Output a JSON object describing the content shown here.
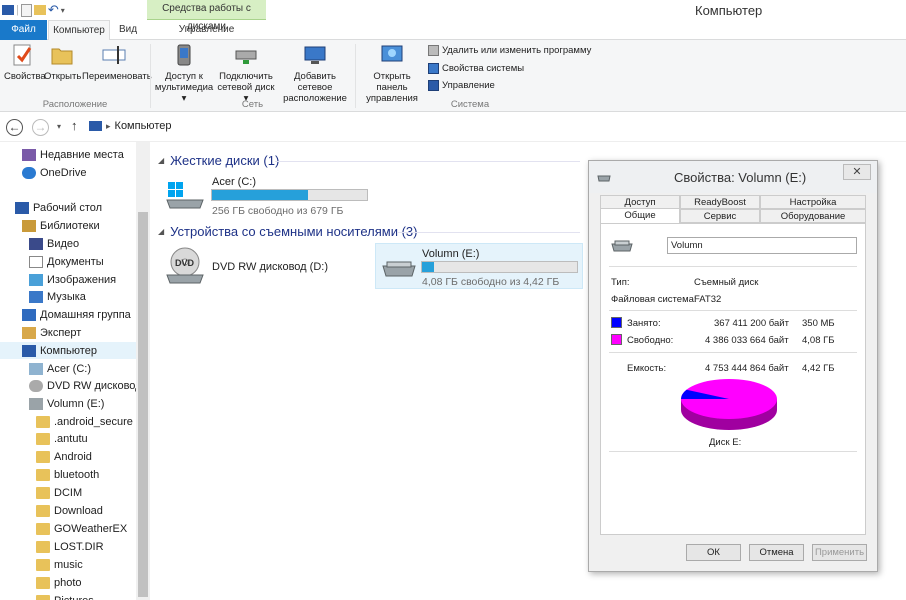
{
  "window": {
    "title": "Компьютер",
    "context_tab": "Средства работы с дисками"
  },
  "tabs": {
    "file": "Файл",
    "computer": "Компьютер",
    "view": "Вид",
    "manage": "Управление"
  },
  "ribbon": {
    "properties": "Свойства",
    "open": "Открыть",
    "rename": "Переименовать",
    "group_location": "Расположение",
    "media_access_1": "Доступ к",
    "media_access_2": "мультимедиа",
    "map_drive_1": "Подключить",
    "map_drive_2": "сетевой диск",
    "add_location_1": "Добавить сетевое",
    "add_location_2": "расположение",
    "group_network": "Сеть",
    "control_panel_1": "Открыть панель",
    "control_panel_2": "управления",
    "uninstall": "Удалить или изменить программу",
    "system_props": "Свойства системы",
    "manage": "Управление",
    "group_system": "Система"
  },
  "address": {
    "path": "Компьютер"
  },
  "nav": {
    "items": [
      "Недавние места",
      "OneDrive",
      "Рабочий стол",
      "Библиотеки",
      "Видео",
      "Документы",
      "Изображения",
      "Музыка",
      "Домашняя группа",
      "Эксперт",
      "Компьютер",
      "Acer (C:)",
      "DVD RW дисковод (",
      "Volumn (E:)",
      ".android_secure",
      ".antutu",
      "Android",
      "bluetooth",
      "DCIM",
      "Download",
      "GOWeatherEX",
      "LOST.DIR",
      "music",
      "photo",
      "Pictures"
    ]
  },
  "content": {
    "hdd_group": "Жесткие диски (1)",
    "removable_group": "Устройства со съемными носителями (3)",
    "drives": [
      {
        "name": "Acer (C:)",
        "free": "256 ГБ свободно из 679 ГБ",
        "used_fraction": 0.62
      },
      {
        "name": "DVD RW дисковод (D:)"
      },
      {
        "name": "Volumn (E:)",
        "free": "4,08 ГБ свободно из 4,42 ГБ",
        "used_fraction": 0.077
      }
    ]
  },
  "dialog": {
    "title": "Свойства: Volumn (E:)",
    "tabs_top": [
      "Доступ",
      "ReadyBoost",
      "Настройка"
    ],
    "tabs_bottom": [
      "Общие",
      "Сервис",
      "Оборудование"
    ],
    "name": "Volumn",
    "type_label": "Тип:",
    "type_value": "Съемный диск",
    "fs_label": "Файловая система:",
    "fs_value": "FAT32",
    "used_label": "Занято:",
    "used_bytes": "367 411 200 байт",
    "used_size": "350 МБ",
    "free_label": "Свободно:",
    "free_bytes": "4 386 033 664 байт",
    "free_size": "4,08 ГБ",
    "capacity_label": "Емкость:",
    "capacity_bytes": "4 753 444 864 байт",
    "capacity_size": "4,42 ГБ",
    "disk_label": "Диск E:",
    "used_color": "#0000ff",
    "free_color": "#ff00ff",
    "used_fraction": 0.077,
    "ok": "ОК",
    "cancel": "Отмена",
    "apply": "Применить"
  }
}
